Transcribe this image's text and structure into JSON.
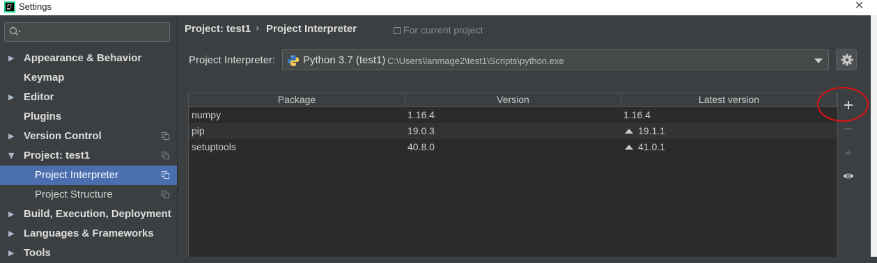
{
  "window": {
    "title": "Settings"
  },
  "search": {
    "placeholder": ""
  },
  "sidebar": {
    "items": [
      {
        "label": "Appearance & Behavior",
        "expandable": true,
        "expanded": false,
        "project_scoped": false
      },
      {
        "label": "Keymap",
        "expandable": false,
        "project_scoped": false
      },
      {
        "label": "Editor",
        "expandable": true,
        "expanded": false,
        "project_scoped": false
      },
      {
        "label": "Plugins",
        "expandable": false,
        "project_scoped": false
      },
      {
        "label": "Version Control",
        "expandable": true,
        "expanded": false,
        "project_scoped": true
      },
      {
        "label": "Project: test1",
        "expandable": true,
        "expanded": true,
        "project_scoped": true
      },
      {
        "label": "Project Interpreter",
        "child": true,
        "selected": true,
        "project_scoped": true
      },
      {
        "label": "Project Structure",
        "child": true,
        "selected": false,
        "project_scoped": true
      },
      {
        "label": "Build, Execution, Deployment",
        "expandable": true,
        "expanded": false,
        "project_scoped": false
      },
      {
        "label": "Languages & Frameworks",
        "expandable": true,
        "expanded": false,
        "project_scoped": false
      },
      {
        "label": "Tools",
        "expandable": true,
        "expanded": false,
        "project_scoped": false
      }
    ]
  },
  "breadcrumb": {
    "parent": "Project: test1",
    "separator": "›",
    "current": "Project Interpreter"
  },
  "scope_note": "For current project",
  "interpreter": {
    "label": "Project Interpreter:",
    "name": "Python 3.7 (test1)",
    "path": "C:\\Users\\lanmage2\\test1\\Scripts\\python.exe"
  },
  "table": {
    "columns": [
      "Package",
      "Version",
      "Latest version"
    ],
    "rows": [
      {
        "package": "numpy",
        "version": "1.16.4",
        "latest": "1.16.4",
        "upgrade": false
      },
      {
        "package": "pip",
        "version": "19.0.3",
        "latest": "19.1.1",
        "upgrade": true
      },
      {
        "package": "setuptools",
        "version": "40.8.0",
        "latest": "41.0.1",
        "upgrade": true
      }
    ]
  },
  "toolbar": {
    "buttons": [
      "add-icon",
      "remove-icon",
      "upgrade-icon",
      "eye-icon"
    ]
  },
  "colors": {
    "selection": "#4b6eaf",
    "annotation_circle": "#e01010",
    "background": "#3c3f41"
  }
}
